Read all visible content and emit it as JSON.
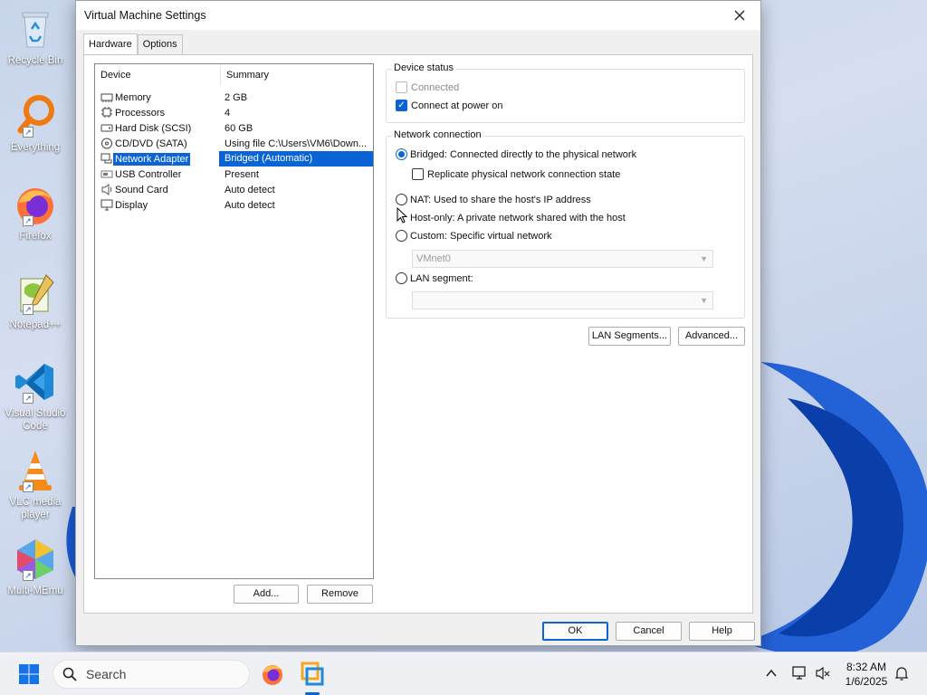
{
  "desktop": {
    "icons": [
      {
        "label": "Recycle Bin",
        "icon": "recycle-bin-icon"
      },
      {
        "label": "Everything",
        "icon": "everything-search-icon"
      },
      {
        "label": "Firefox",
        "icon": "firefox-icon"
      },
      {
        "label": "Notepad++",
        "icon": "notepad-plus-plus-icon"
      },
      {
        "label": "Visual Studio Code",
        "icon": "vscode-icon"
      },
      {
        "label": "VLC media player",
        "icon": "vlc-icon"
      },
      {
        "label": "Multi-MEmu",
        "icon": "multi-memu-icon"
      }
    ]
  },
  "dialog": {
    "title": "Virtual Machine Settings",
    "tabs": [
      {
        "label": "Hardware",
        "active": true
      },
      {
        "label": "Options",
        "active": false
      }
    ],
    "device_list": {
      "headers": {
        "device": "Device",
        "summary": "Summary"
      },
      "rows": [
        {
          "device": "Memory",
          "summary": "2 GB",
          "icon": "memory-icon"
        },
        {
          "device": "Processors",
          "summary": "4",
          "icon": "processor-icon"
        },
        {
          "device": "Hard Disk (SCSI)",
          "summary": "60 GB",
          "icon": "hard-disk-icon"
        },
        {
          "device": "CD/DVD (SATA)",
          "summary": "Using file C:\\Users\\VM6\\Down...",
          "icon": "cd-dvd-icon"
        },
        {
          "device": "Network Adapter",
          "summary": "Bridged (Automatic)",
          "icon": "network-adapter-icon",
          "selected": true
        },
        {
          "device": "USB Controller",
          "summary": "Present",
          "icon": "usb-icon"
        },
        {
          "device": "Sound Card",
          "summary": "Auto detect",
          "icon": "speaker-icon"
        },
        {
          "device": "Display",
          "summary": "Auto detect",
          "icon": "monitor-icon"
        }
      ]
    },
    "add_label": "Add...",
    "remove_label": "Remove",
    "device_status": {
      "label": "Device status",
      "connected": "Connected",
      "connect_at_power_on": "Connect at power on"
    },
    "network_connection": {
      "label": "Network connection",
      "bridged": "Bridged: Connected directly to the physical network",
      "replicate": "Replicate physical network connection state",
      "nat": "NAT: Used to share the host's IP address",
      "host_only": "Host-only: A private network shared with the host",
      "custom": "Custom: Specific virtual network",
      "custom_value": "VMnet0",
      "lan_segment": "LAN segment:",
      "lan_segment_value": ""
    },
    "lan_segments_label": "LAN Segments...",
    "advanced_label": "Advanced...",
    "ok_label": "OK",
    "cancel_label": "Cancel",
    "help_label": "Help"
  },
  "taskbar": {
    "search_placeholder": "Search",
    "time": "8:32 AM",
    "date": "1/6/2025"
  },
  "colors": {
    "accent": "#0a64d6",
    "dialog_bg": "#f0f0f0"
  }
}
